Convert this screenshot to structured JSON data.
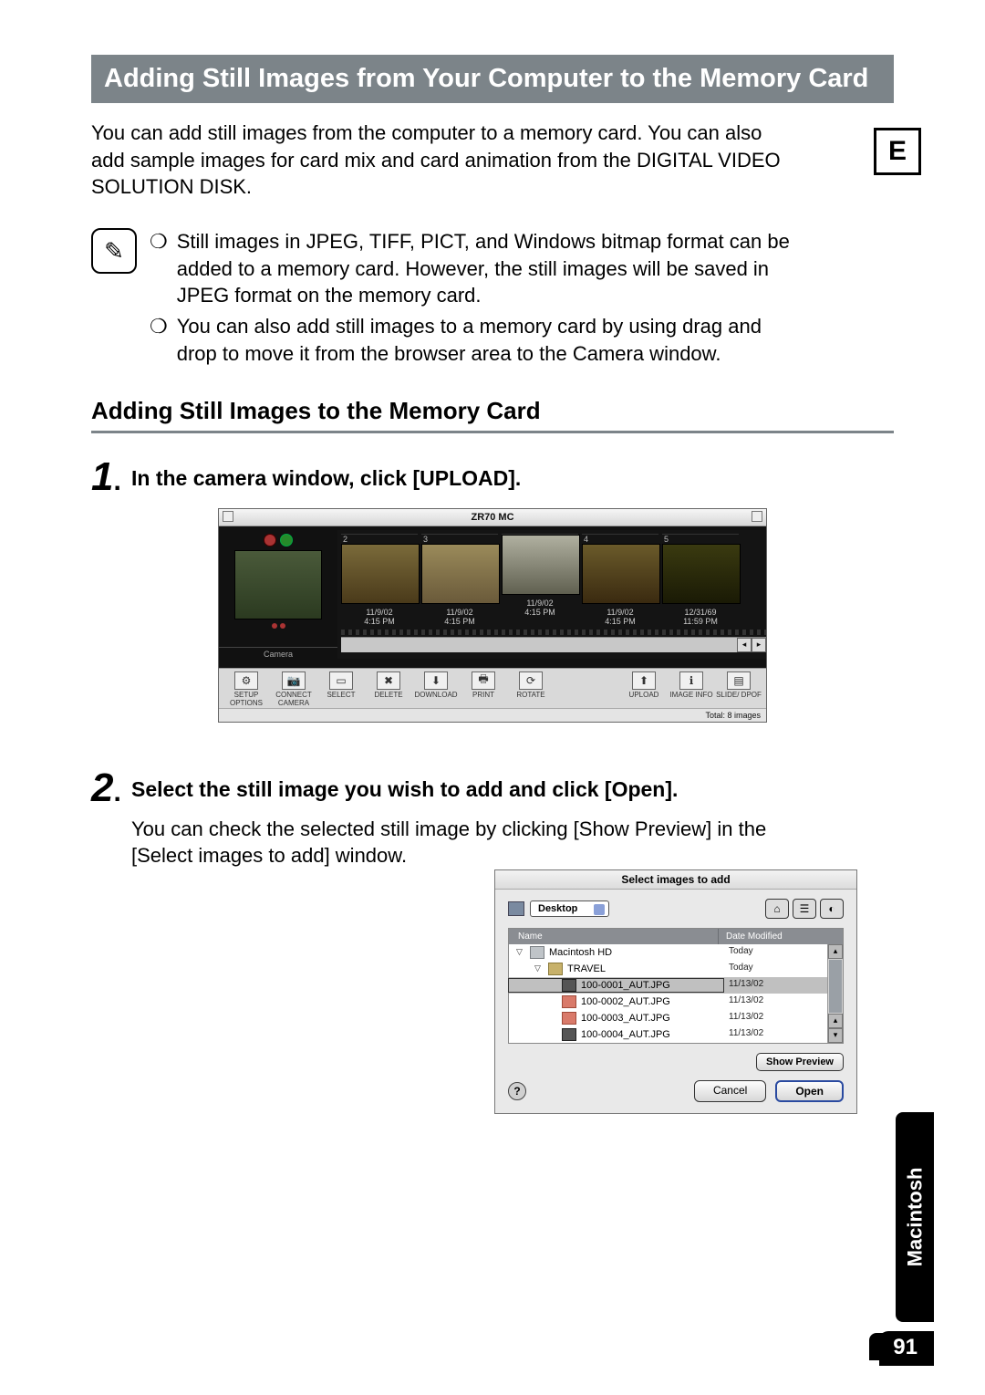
{
  "side_tab": "E",
  "mac_tab": "Macintosh",
  "page_number": "91",
  "title": "Adding Still Images from Your Computer to the Memory Card",
  "intro": "You can add still images from the computer to a memory card. You can also add sample images for card mix and card animation from the DIGITAL VIDEO SOLUTION DISK.",
  "notes": {
    "b1": "Still images in JPEG, TIFF, PICT, and Windows bitmap format can be added to a memory card. However, the still images will be saved in JPEG format on the memory card.",
    "b2": "You can also add still images to a memory card by using drag and drop to move it from the browser area to the Camera window."
  },
  "subheading": "Adding Still Images to the Memory Card",
  "step1": {
    "num": "1",
    "dot": ".",
    "title": "In the camera window, click [UPLOAD]."
  },
  "step2": {
    "num": "2",
    "dot": ".",
    "title": "Select the still image you wish to add and click [Open].",
    "body": "You can check the selected still image by clicking [Show Preview] in the [Select images to add] window."
  },
  "camera": {
    "title": "ZR70 MC",
    "camera_label": "Camera",
    "status": "Total: 8 images",
    "thumbs": [
      {
        "idx": "2",
        "date": "11/9/02",
        "time": "4:15 PM"
      },
      {
        "idx": "3",
        "date": "11/9/02",
        "time": "4:15 PM"
      },
      {
        "idx": "",
        "date": "11/9/02",
        "time": "4:15 PM"
      },
      {
        "idx": "4",
        "date": "11/9/02",
        "time": "4:15 PM"
      },
      {
        "idx": "5",
        "date": "12/31/69",
        "time": "11:59 PM"
      }
    ],
    "tools": {
      "setup": "SETUP OPTIONS",
      "connect": "CONNECT CAMERA",
      "select": "SELECT",
      "delete": "DELETE",
      "download": "DOWNLOAD",
      "print": "PRINT",
      "rotate": "ROTATE",
      "upload": "UPLOAD",
      "info": "IMAGE INFO",
      "slide": "SLIDE/ DPOF"
    }
  },
  "dialog": {
    "title": "Select images to add",
    "location": "Desktop",
    "col_name": "Name",
    "col_date": "Date Modified",
    "rows": [
      {
        "name": "Macintosh HD",
        "date": "Today"
      },
      {
        "name": "TRAVEL",
        "date": "Today"
      },
      {
        "name": "100-0001_AUT.JPG",
        "date": "11/13/02"
      },
      {
        "name": "100-0002_AUT.JPG",
        "date": "11/13/02"
      },
      {
        "name": "100-0003_AUT.JPG",
        "date": "11/13/02"
      },
      {
        "name": "100-0004_AUT.JPG",
        "date": "11/13/02"
      }
    ],
    "show_preview": "Show Preview",
    "cancel": "Cancel",
    "open": "Open"
  },
  "bullet_mark": "❍"
}
